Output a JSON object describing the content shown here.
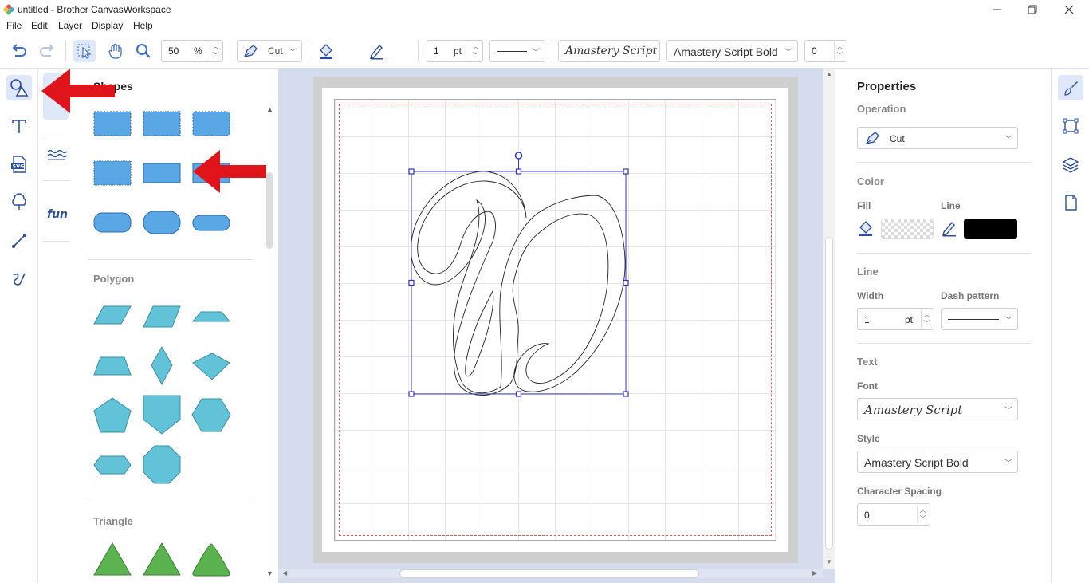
{
  "window": {
    "title": "untitled - Brother CanvasWorkspace"
  },
  "menu": [
    "File",
    "Edit",
    "Layer",
    "Display",
    "Help"
  ],
  "toolbar": {
    "zoom_value": "50",
    "zoom_unit": "%",
    "operation": "Cut",
    "line_width": "1",
    "line_width_unit": "pt",
    "font": "Amastery Script",
    "style": "Amastery Script Bold",
    "spacing": "0",
    "line_color": "#000000"
  },
  "shapes_panel": {
    "sections": [
      {
        "title": "Shapes"
      },
      {
        "title": "Polygon"
      },
      {
        "title": "Triangle"
      }
    ],
    "shape_blue": "#5aa7e6",
    "polygon_color": "#62c3d8",
    "triangle_color": "#5bb350"
  },
  "canvas": {
    "glyph": "D",
    "cut_guide_color": "#e55555",
    "selection_color": "#3333cc"
  },
  "properties": {
    "title": "Properties",
    "operation": {
      "label": "Operation",
      "value": "Cut"
    },
    "color": {
      "label": "Color",
      "fill_label": "Fill",
      "line_label": "Line"
    },
    "line": {
      "label": "Line",
      "width_label": "Width",
      "width_value": "1",
      "width_unit": "pt",
      "dash_label": "Dash pattern"
    },
    "text": {
      "label": "Text",
      "font_label": "Font",
      "font_value": "Amastery Script",
      "style_label": "Style",
      "style_value": "Amastery Script Bold",
      "spacing_label": "Character Spacing",
      "spacing_value": "0"
    }
  },
  "annotations": {
    "arrow_color": "#e0141b"
  }
}
